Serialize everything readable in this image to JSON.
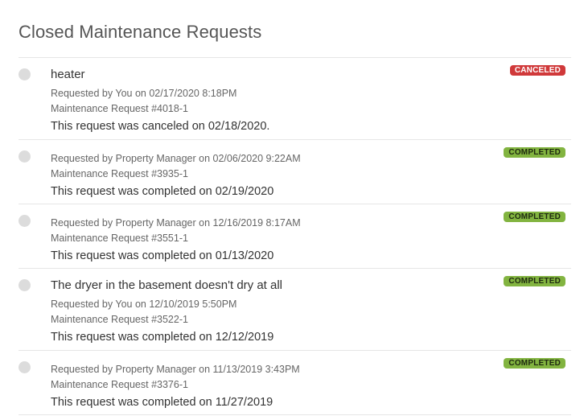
{
  "page": {
    "title": "Closed Maintenance Requests"
  },
  "colors": {
    "canceled_badge": "#d0393a",
    "completed_badge": "#82b440",
    "status_dot": "#dcdcdc"
  },
  "requests": [
    {
      "title": "heater",
      "requested_by": "Requested by You on 02/17/2020 8:18PM",
      "number": "Maintenance Request #4018-1",
      "summary": "This request was canceled on 02/18/2020.",
      "status": "CANCELED"
    },
    {
      "title": "",
      "requested_by": "Requested by Property Manager on 02/06/2020 9:22AM",
      "number": "Maintenance Request #3935-1",
      "summary": "This request was completed on 02/19/2020",
      "status": "COMPLETED"
    },
    {
      "title": "",
      "requested_by": "Requested by Property Manager on 12/16/2019 8:17AM",
      "number": "Maintenance Request #3551-1",
      "summary": "This request was completed on 01/13/2020",
      "status": "COMPLETED"
    },
    {
      "title": "The dryer in the basement doesn't dry at all",
      "requested_by": "Requested by You on 12/10/2019 5:50PM",
      "number": "Maintenance Request #3522-1",
      "summary": "This request was completed on 12/12/2019",
      "status": "COMPLETED"
    },
    {
      "title": "",
      "requested_by": "Requested by Property Manager on 11/13/2019 3:43PM",
      "number": "Maintenance Request #3376-1",
      "summary": "This request was completed on 11/27/2019",
      "status": "COMPLETED"
    }
  ]
}
